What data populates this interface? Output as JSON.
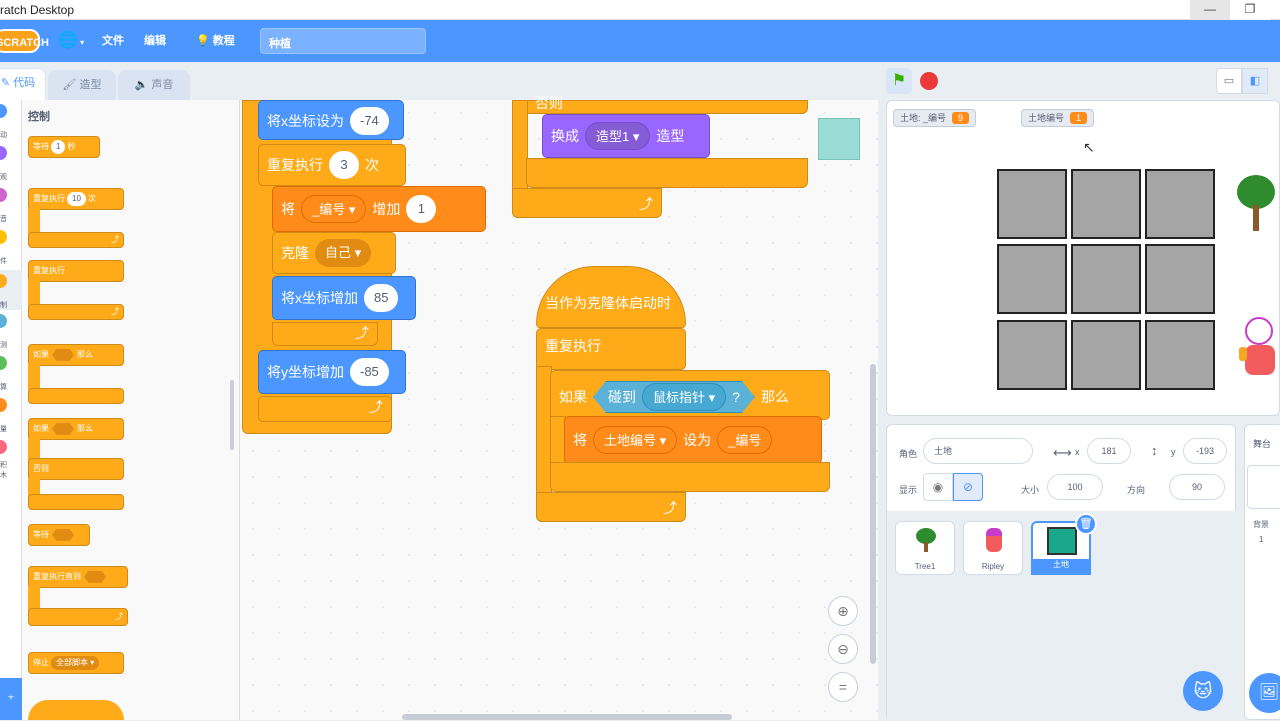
{
  "window": {
    "title": "ratch Desktop",
    "minimize": "—",
    "restore": "❐"
  },
  "menubar": {
    "logo": "SCRATCH",
    "file": "文件",
    "edit": "编辑",
    "tutorials": "教程",
    "project_name": "种植"
  },
  "tabs": {
    "code": "代码",
    "costumes": "造型",
    "sounds": "声音"
  },
  "categories": [
    {
      "label": "动",
      "color": "#4c97ff"
    },
    {
      "label": "观",
      "color": "#9966ff"
    },
    {
      "label": "音",
      "color": "#cf63cf"
    },
    {
      "label": "件",
      "color": "#ffbf00"
    },
    {
      "label": "制",
      "color": "#ffab19"
    },
    {
      "label": "测",
      "color": "#5cb1d6"
    },
    {
      "label": "算",
      "color": "#59c059"
    },
    {
      "label": "量",
      "color": "#ff8c1a"
    },
    {
      "label": "积木",
      "color": "#ff6680"
    }
  ],
  "palette": {
    "heading": "控制",
    "wait": "等待",
    "wait_val": "1",
    "wait_unit": "秒",
    "repeat": "重复执行",
    "repeat_val": "10",
    "repeat_unit": "次",
    "forever": "重复执行",
    "if": "如果",
    "then": "那么",
    "if2": "如果",
    "then2": "那么",
    "else": "否则",
    "wait_until": "等待",
    "repeat_until": "重复执行直到",
    "stop": "停止",
    "stop_opt": "全部脚本"
  },
  "script1": {
    "set_x": "将x坐标设为",
    "set_x_val": "-74",
    "repeat": "重复执行",
    "repeat_val": "3",
    "repeat_unit": "次",
    "change": "将",
    "change_var": "_编号",
    "change_by": "增加",
    "change_val": "1",
    "clone": "克隆",
    "clone_target": "自己",
    "change_x": "将x坐标增加",
    "change_x_val": "85",
    "change_y": "将y坐标增加",
    "change_y_val": "-85"
  },
  "script2": {
    "else_label": "否则",
    "switch": "换成",
    "switch_val": "造型1",
    "switch_unit": "造型"
  },
  "script3": {
    "hat": "当作为克隆体启动时",
    "forever": "重复执行",
    "if": "如果",
    "touching": "碰到",
    "touching_target": "鼠标指针",
    "q": "?",
    "then": "那么",
    "set": "将",
    "set_var": "土地编号",
    "set_to": "设为",
    "set_val": "_编号"
  },
  "stage": {
    "monitor1_label": "土地: _编号",
    "monitor1_val": "9",
    "monitor2_label": "土地编号",
    "monitor2_val": "1"
  },
  "sprite_info": {
    "sprite_label": "角色",
    "sprite_name": "土地",
    "x_label": "x",
    "x_val": "181",
    "y_label": "y",
    "y_val": "-193",
    "show_label": "显示",
    "size_label": "大小",
    "size_val": "100",
    "dir_label": "方向",
    "dir_val": "90"
  },
  "sprites": [
    {
      "name": "Tree1"
    },
    {
      "name": "Ripley"
    },
    {
      "name": "土地",
      "selected": true
    }
  ],
  "stage_panel": {
    "label": "舞台",
    "backdrops_label": "背景",
    "backdrops_val": "1"
  },
  "colors": {
    "accent": "#4c97ff",
    "control": "#ffab19",
    "motion": "#4c97ff",
    "variables": "#ff8c1a",
    "looks": "#9966ff",
    "sensing": "#5cb1d6"
  }
}
